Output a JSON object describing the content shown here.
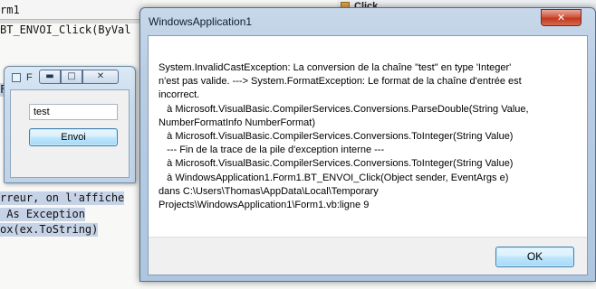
{
  "editor": {
    "tab_title": "rm1",
    "code_lines": [
      "BT_ENVOI_Click(ByVal",
      "F",
      "rreur, on l'affiche",
      " As Exception",
      "ox(ex.ToString)"
    ],
    "right_pane_label": "Click"
  },
  "form1": {
    "title": "F",
    "textbox_value": "test",
    "button_label": "Envoi",
    "min_glyph": "▬",
    "max_glyph": "□",
    "close_glyph": "✕"
  },
  "messagebox": {
    "title": "WindowsApplication1",
    "close_glyph": "✕",
    "message_lines": [
      "System.InvalidCastException: La conversion de la chaîne \"test\" en type 'Integer'",
      "n'est pas valide. ---> System.FormatException: Le format de la chaîne d'entrée est",
      "incorrect.",
      "   à Microsoft.VisualBasic.CompilerServices.Conversions.ParseDouble(String Value,",
      "NumberFormatInfo NumberFormat)",
      "   à Microsoft.VisualBasic.CompilerServices.Conversions.ToInteger(String Value)",
      "   --- Fin de la trace de la pile d'exception interne ---",
      "   à Microsoft.VisualBasic.CompilerServices.Conversions.ToInteger(String Value)",
      "   à WindowsApplication1.Form1.BT_ENVOI_Click(Object sender, EventArgs e)",
      "dans C:\\Users\\Thomas\\AppData\\Local\\Temporary",
      "Projects\\WindowsApplication1\\Form1.vb:ligne 9"
    ],
    "ok_label": "OK"
  }
}
